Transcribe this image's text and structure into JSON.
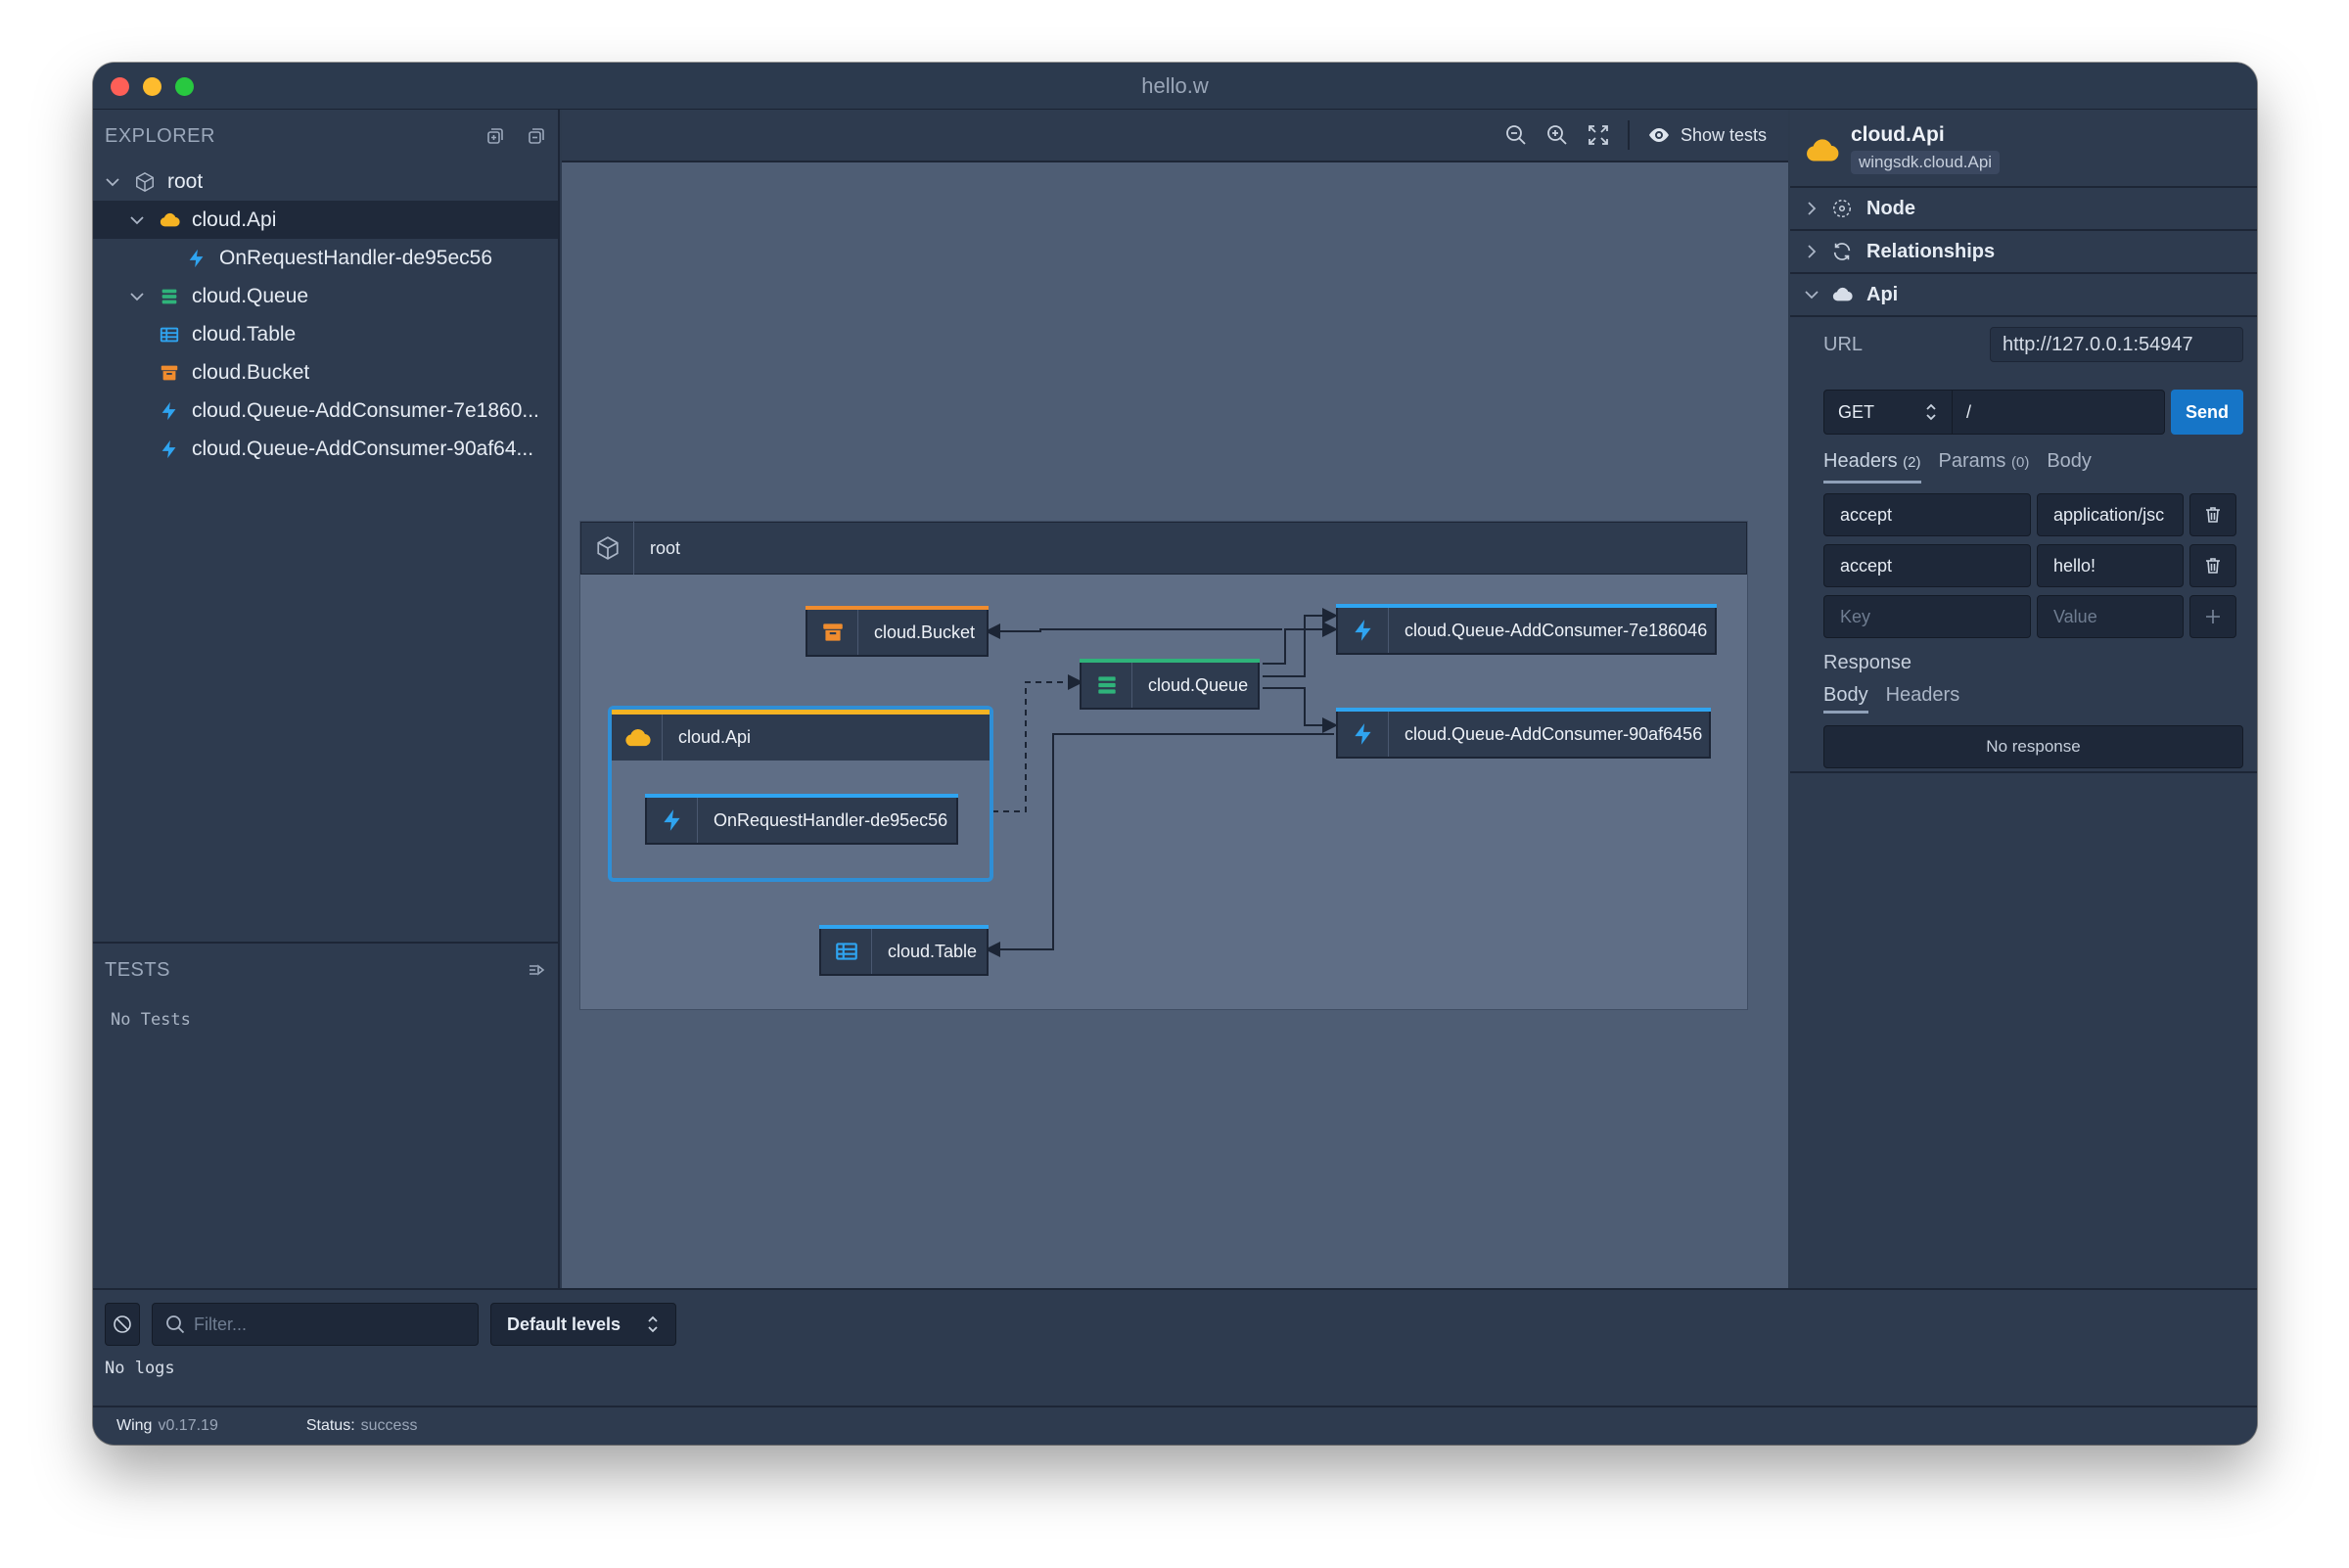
{
  "window": {
    "title": "hello.w"
  },
  "explorer": {
    "title": "EXPLORER",
    "items": [
      {
        "label": "root",
        "icon": "cube-icon",
        "depth": 0,
        "expandable": true
      },
      {
        "label": "cloud.Api",
        "icon": "cloud-icon",
        "depth": 1,
        "expandable": true,
        "selected": true
      },
      {
        "label": "OnRequestHandler-de95ec56",
        "icon": "lightning-icon",
        "depth": 2
      },
      {
        "label": "cloud.Queue",
        "icon": "queue-icon",
        "depth": 1,
        "expandable": true
      },
      {
        "label": "cloud.Table",
        "icon": "table-icon",
        "depth": 1
      },
      {
        "label": "cloud.Bucket",
        "icon": "bucket-icon",
        "depth": 1
      },
      {
        "label": "cloud.Queue-AddConsumer-7e1860...",
        "icon": "lightning-icon",
        "depth": 1
      },
      {
        "label": "cloud.Queue-AddConsumer-90af64...",
        "icon": "lightning-icon",
        "depth": 1
      }
    ]
  },
  "tests": {
    "title": "TESTS",
    "empty": "No Tests"
  },
  "canvas": {
    "show_tests": "Show tests",
    "root_label": "root",
    "nodes": {
      "bucket": "cloud.Bucket",
      "queue": "cloud.Queue",
      "consumer1": "cloud.Queue-AddConsumer-7e186046",
      "consumer2": "cloud.Queue-AddConsumer-90af6456",
      "api": "cloud.Api",
      "handler": "OnRequestHandler-de95ec56",
      "table": "cloud.Table"
    }
  },
  "inspector": {
    "title": "cloud.Api",
    "subtitle": "wingsdk.cloud.Api",
    "sections": {
      "node": "Node",
      "relationships": "Relationships",
      "api": "Api"
    },
    "url_label": "URL",
    "url": "http://127.0.0.1:54947",
    "method": "GET",
    "path": "/",
    "send": "Send",
    "tabs": {
      "headers": "Headers",
      "headers_count": "(2)",
      "params": "Params",
      "params_count": "(0)",
      "body": "Body"
    },
    "headers": [
      {
        "key": "accept",
        "value": "application/jsc"
      },
      {
        "key": "accept",
        "value": "hello!"
      }
    ],
    "new_key_placeholder": "Key",
    "new_value_placeholder": "Value",
    "response_label": "Response",
    "response_tabs": {
      "body": "Body",
      "headers": "Headers"
    },
    "no_response": "No response"
  },
  "logs": {
    "filter_placeholder": "Filter...",
    "levels": "Default levels",
    "empty": "No logs"
  },
  "status": {
    "app_key": "Wing",
    "app_version": "v0.17.19",
    "status_key": "Status:",
    "status_value": "success"
  },
  "colors": {
    "accent_blue": "#2f8fd6",
    "api_yellow": "#f5b323",
    "bucket_orange": "#f08c2e",
    "queue_green": "#2fb37a",
    "send_button": "#1675c7"
  }
}
